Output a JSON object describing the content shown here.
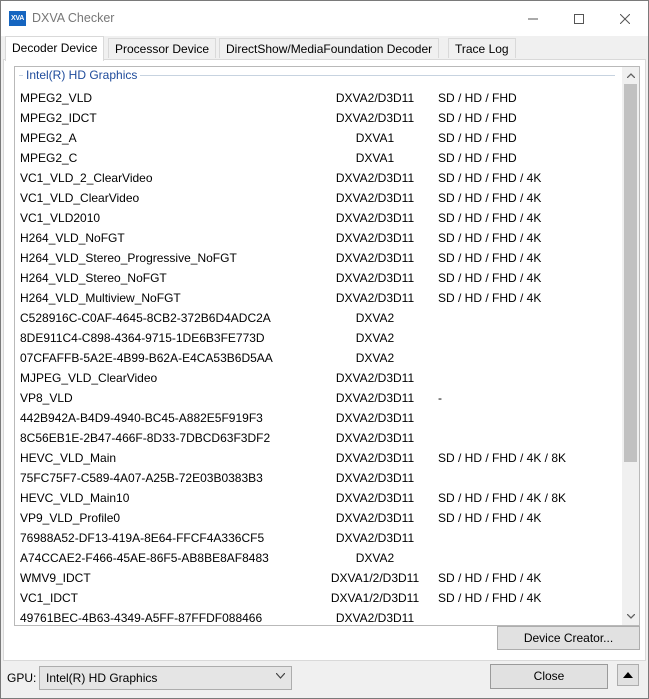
{
  "window": {
    "title": "DXVA Checker",
    "icon_text": "XVA"
  },
  "tabs": [
    {
      "label": "Decoder Device",
      "active": true
    },
    {
      "label": "Processor Device",
      "active": false
    },
    {
      "label": "DirectShow/MediaFoundation Decoder",
      "active": false
    },
    {
      "label": "Trace Log",
      "active": false
    }
  ],
  "list": {
    "group_header": "Intel(R) HD Graphics",
    "rows": [
      {
        "name": "MPEG2_VLD",
        "api": "DXVA2/D3D11",
        "res": "SD / HD / FHD"
      },
      {
        "name": "MPEG2_IDCT",
        "api": "DXVA2/D3D11",
        "res": "SD / HD / FHD"
      },
      {
        "name": "MPEG2_A",
        "api": "DXVA1",
        "res": "SD / HD / FHD"
      },
      {
        "name": "MPEG2_C",
        "api": "DXVA1",
        "res": "SD / HD / FHD"
      },
      {
        "name": "VC1_VLD_2_ClearVideo",
        "api": "DXVA2/D3D11",
        "res": "SD / HD / FHD / 4K"
      },
      {
        "name": "VC1_VLD_ClearVideo",
        "api": "DXVA2/D3D11",
        "res": "SD / HD / FHD / 4K"
      },
      {
        "name": "VC1_VLD2010",
        "api": "DXVA2/D3D11",
        "res": "SD / HD / FHD / 4K"
      },
      {
        "name": "H264_VLD_NoFGT",
        "api": "DXVA2/D3D11",
        "res": "SD / HD / FHD / 4K"
      },
      {
        "name": "H264_VLD_Stereo_Progressive_NoFGT",
        "api": "DXVA2/D3D11",
        "res": "SD / HD / FHD / 4K"
      },
      {
        "name": "H264_VLD_Stereo_NoFGT",
        "api": "DXVA2/D3D11",
        "res": "SD / HD / FHD / 4K"
      },
      {
        "name": "H264_VLD_Multiview_NoFGT",
        "api": "DXVA2/D3D11",
        "res": "SD / HD / FHD / 4K"
      },
      {
        "name": "C528916C-C0AF-4645-8CB2-372B6D4ADC2A",
        "api": "DXVA2",
        "res": ""
      },
      {
        "name": "8DE911C4-C898-4364-9715-1DE6B3FE773D",
        "api": "DXVA2",
        "res": ""
      },
      {
        "name": "07CFAFFB-5A2E-4B99-B62A-E4CA53B6D5AA",
        "api": "DXVA2",
        "res": ""
      },
      {
        "name": "MJPEG_VLD_ClearVideo",
        "api": "DXVA2/D3D11",
        "res": ""
      },
      {
        "name": "VP8_VLD",
        "api": "DXVA2/D3D11",
        "res": "-"
      },
      {
        "name": "442B942A-B4D9-4940-BC45-A882E5F919F3",
        "api": "DXVA2/D3D11",
        "res": ""
      },
      {
        "name": "8C56EB1E-2B47-466F-8D33-7DBCD63F3DF2",
        "api": "DXVA2/D3D11",
        "res": ""
      },
      {
        "name": "HEVC_VLD_Main",
        "api": "DXVA2/D3D11",
        "res": "SD / HD / FHD / 4K / 8K"
      },
      {
        "name": "75FC75F7-C589-4A07-A25B-72E03B0383B3",
        "api": "DXVA2/D3D11",
        "res": ""
      },
      {
        "name": "HEVC_VLD_Main10",
        "api": "DXVA2/D3D11",
        "res": "SD / HD / FHD / 4K / 8K"
      },
      {
        "name": "VP9_VLD_Profile0",
        "api": "DXVA2/D3D11",
        "res": "SD / HD / FHD / 4K"
      },
      {
        "name": "76988A52-DF13-419A-8E64-FFCF4A336CF5",
        "api": "DXVA2/D3D11",
        "res": ""
      },
      {
        "name": "A74CCAE2-F466-45AE-86F5-AB8BE8AF8483",
        "api": "DXVA2",
        "res": ""
      },
      {
        "name": "WMV9_IDCT",
        "api": "DXVA1/2/D3D11",
        "res": "SD / HD / FHD / 4K"
      },
      {
        "name": "VC1_IDCT",
        "api": "DXVA1/2/D3D11",
        "res": "SD / HD / FHD / 4K"
      },
      {
        "name": "49761BEC-4B63-4349-A5FF-87FFDF088466",
        "api": "DXVA2/D3D11",
        "res": ""
      }
    ]
  },
  "buttons": {
    "device_creator": "Device Creator...",
    "close": "Close"
  },
  "gpu": {
    "label": "GPU:",
    "selected": "Intel(R) HD Graphics"
  },
  "colors": {
    "group_header": "#1e4b9b",
    "icon_bg": "#1565c0"
  }
}
